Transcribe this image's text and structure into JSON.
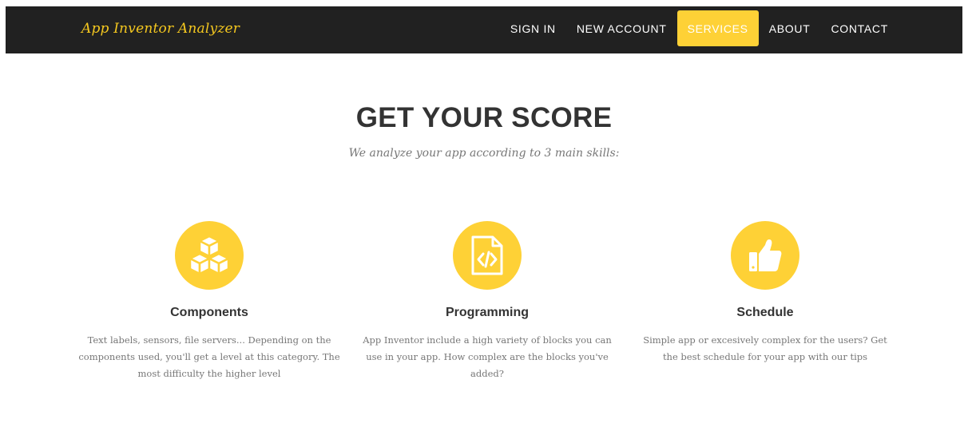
{
  "nav": {
    "brand": "App Inventor Analyzer",
    "links": [
      {
        "label": "SIGN IN",
        "active": false
      },
      {
        "label": "NEW ACCOUNT",
        "active": false
      },
      {
        "label": "SERVICES",
        "active": true
      },
      {
        "label": "ABOUT",
        "active": false
      },
      {
        "label": "CONTACT",
        "active": false
      }
    ]
  },
  "services_section": {
    "heading": "GET YOUR SCORE",
    "subheading": "We analyze your app according to 3 main skills:",
    "items": [
      {
        "icon": "cubes-icon",
        "title": "Components",
        "description": "Text labels, sensors, file servers... Depending on the components used, you'll get a level at this category. The most difficulty the higher level"
      },
      {
        "icon": "file-code-icon",
        "title": "Programming",
        "description": "App Inventor include a high variety of blocks you can use in your app. How complex are the blocks you've added?"
      },
      {
        "icon": "thumbs-up-icon",
        "title": "Schedule",
        "description": "Simple app or excesively complex for the users? Get the best schedule for your app with our tips"
      }
    ]
  },
  "colors": {
    "navbar_bg": "#212121",
    "accent": "#fed136",
    "brand_text": "#f5c81f",
    "heading_text": "#333333",
    "body_text": "#777777"
  }
}
